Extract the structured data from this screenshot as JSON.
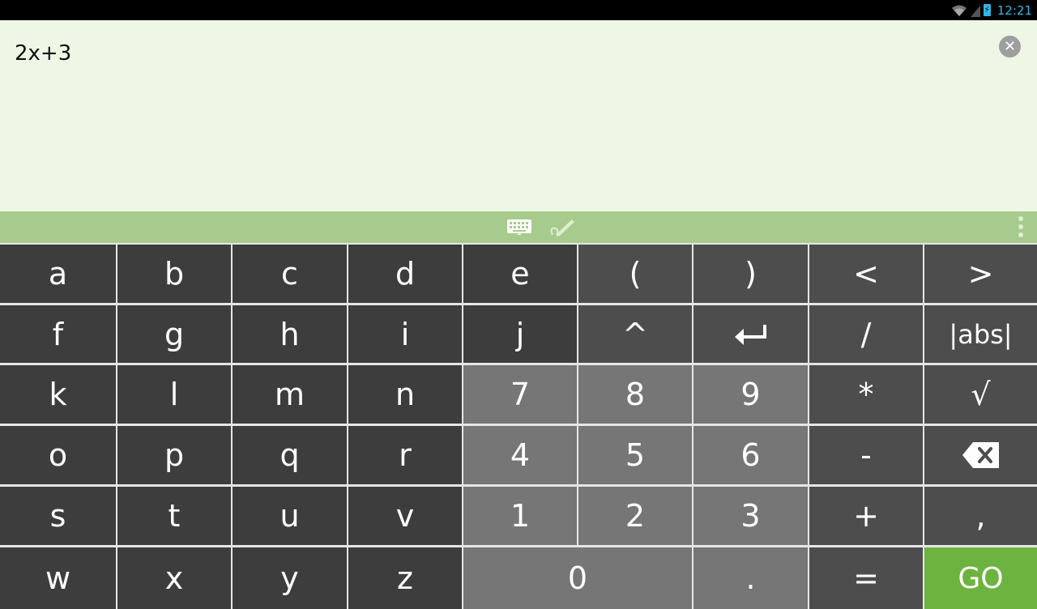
{
  "status_bar": {
    "time": "12:21"
  },
  "expression": {
    "value": "2x+3"
  },
  "toolbar": {
    "keyboard_mode_icon": "keyboard-icon",
    "handwriting_mode_icon": "pen-icon",
    "more_icon": "more-vertical-icon"
  },
  "keys": [
    {
      "id": "a",
      "label": "a",
      "type": "letter"
    },
    {
      "id": "b",
      "label": "b",
      "type": "letter"
    },
    {
      "id": "c",
      "label": "c",
      "type": "letter"
    },
    {
      "id": "d",
      "label": "d",
      "type": "letter"
    },
    {
      "id": "e",
      "label": "e",
      "type": "letter"
    },
    {
      "id": "open-paren",
      "label": "(",
      "type": "op"
    },
    {
      "id": "close-paren",
      "label": ")",
      "type": "op"
    },
    {
      "id": "less-than",
      "label": "<",
      "type": "op"
    },
    {
      "id": "greater-than",
      "label": ">",
      "type": "op"
    },
    {
      "id": "f",
      "label": "f",
      "type": "letter"
    },
    {
      "id": "g",
      "label": "g",
      "type": "letter"
    },
    {
      "id": "h",
      "label": "h",
      "type": "letter"
    },
    {
      "id": "i",
      "label": "i",
      "type": "letter"
    },
    {
      "id": "j",
      "label": "j",
      "type": "letter"
    },
    {
      "id": "caret",
      "label": "^",
      "type": "op"
    },
    {
      "id": "enter",
      "label": "↵",
      "type": "op",
      "icon": "enter-icon"
    },
    {
      "id": "divide",
      "label": "/",
      "type": "op"
    },
    {
      "id": "abs",
      "label": "|abs|",
      "type": "op"
    },
    {
      "id": "k",
      "label": "k",
      "type": "letter"
    },
    {
      "id": "l",
      "label": "l",
      "type": "letter"
    },
    {
      "id": "m",
      "label": "m",
      "type": "letter"
    },
    {
      "id": "n",
      "label": "n",
      "type": "letter"
    },
    {
      "id": "7",
      "label": "7",
      "type": "num"
    },
    {
      "id": "8",
      "label": "8",
      "type": "num"
    },
    {
      "id": "9",
      "label": "9",
      "type": "num"
    },
    {
      "id": "multiply",
      "label": "*",
      "type": "op"
    },
    {
      "id": "sqrt",
      "label": "√",
      "type": "op"
    },
    {
      "id": "o",
      "label": "o",
      "type": "letter"
    },
    {
      "id": "p",
      "label": "p",
      "type": "letter"
    },
    {
      "id": "q",
      "label": "q",
      "type": "letter"
    },
    {
      "id": "r",
      "label": "r",
      "type": "letter"
    },
    {
      "id": "4",
      "label": "4",
      "type": "num"
    },
    {
      "id": "5",
      "label": "5",
      "type": "num"
    },
    {
      "id": "6",
      "label": "6",
      "type": "num"
    },
    {
      "id": "minus",
      "label": "-",
      "type": "op"
    },
    {
      "id": "backspace",
      "label": "",
      "type": "op",
      "icon": "backspace-icon"
    },
    {
      "id": "s",
      "label": "s",
      "type": "letter"
    },
    {
      "id": "t",
      "label": "t",
      "type": "letter"
    },
    {
      "id": "u",
      "label": "u",
      "type": "letter"
    },
    {
      "id": "v",
      "label": "v",
      "type": "letter"
    },
    {
      "id": "1",
      "label": "1",
      "type": "num"
    },
    {
      "id": "2",
      "label": "2",
      "type": "num"
    },
    {
      "id": "3",
      "label": "3",
      "type": "num"
    },
    {
      "id": "plus",
      "label": "+",
      "type": "op"
    },
    {
      "id": "comma",
      "label": ",",
      "type": "op"
    },
    {
      "id": "w",
      "label": "w",
      "type": "letter"
    },
    {
      "id": "x",
      "label": "x",
      "type": "letter"
    },
    {
      "id": "y",
      "label": "y",
      "type": "letter"
    },
    {
      "id": "z",
      "label": "z",
      "type": "letter"
    },
    {
      "id": "0",
      "label": "0",
      "type": "num"
    },
    {
      "id": "dot",
      "label": ".",
      "type": "num"
    },
    {
      "id": "equals",
      "label": "=",
      "type": "op"
    },
    {
      "id": "go",
      "label": "GO",
      "type": "go"
    }
  ],
  "colors": {
    "input_bg": "#eef7e6",
    "toolbar_bg": "#a7cb8c",
    "letter_key": "#3d3d3d",
    "op_key": "#4d4d4d",
    "num_key": "#767676",
    "go_key": "#6cb33f",
    "status_accent": "#33b5e5"
  }
}
